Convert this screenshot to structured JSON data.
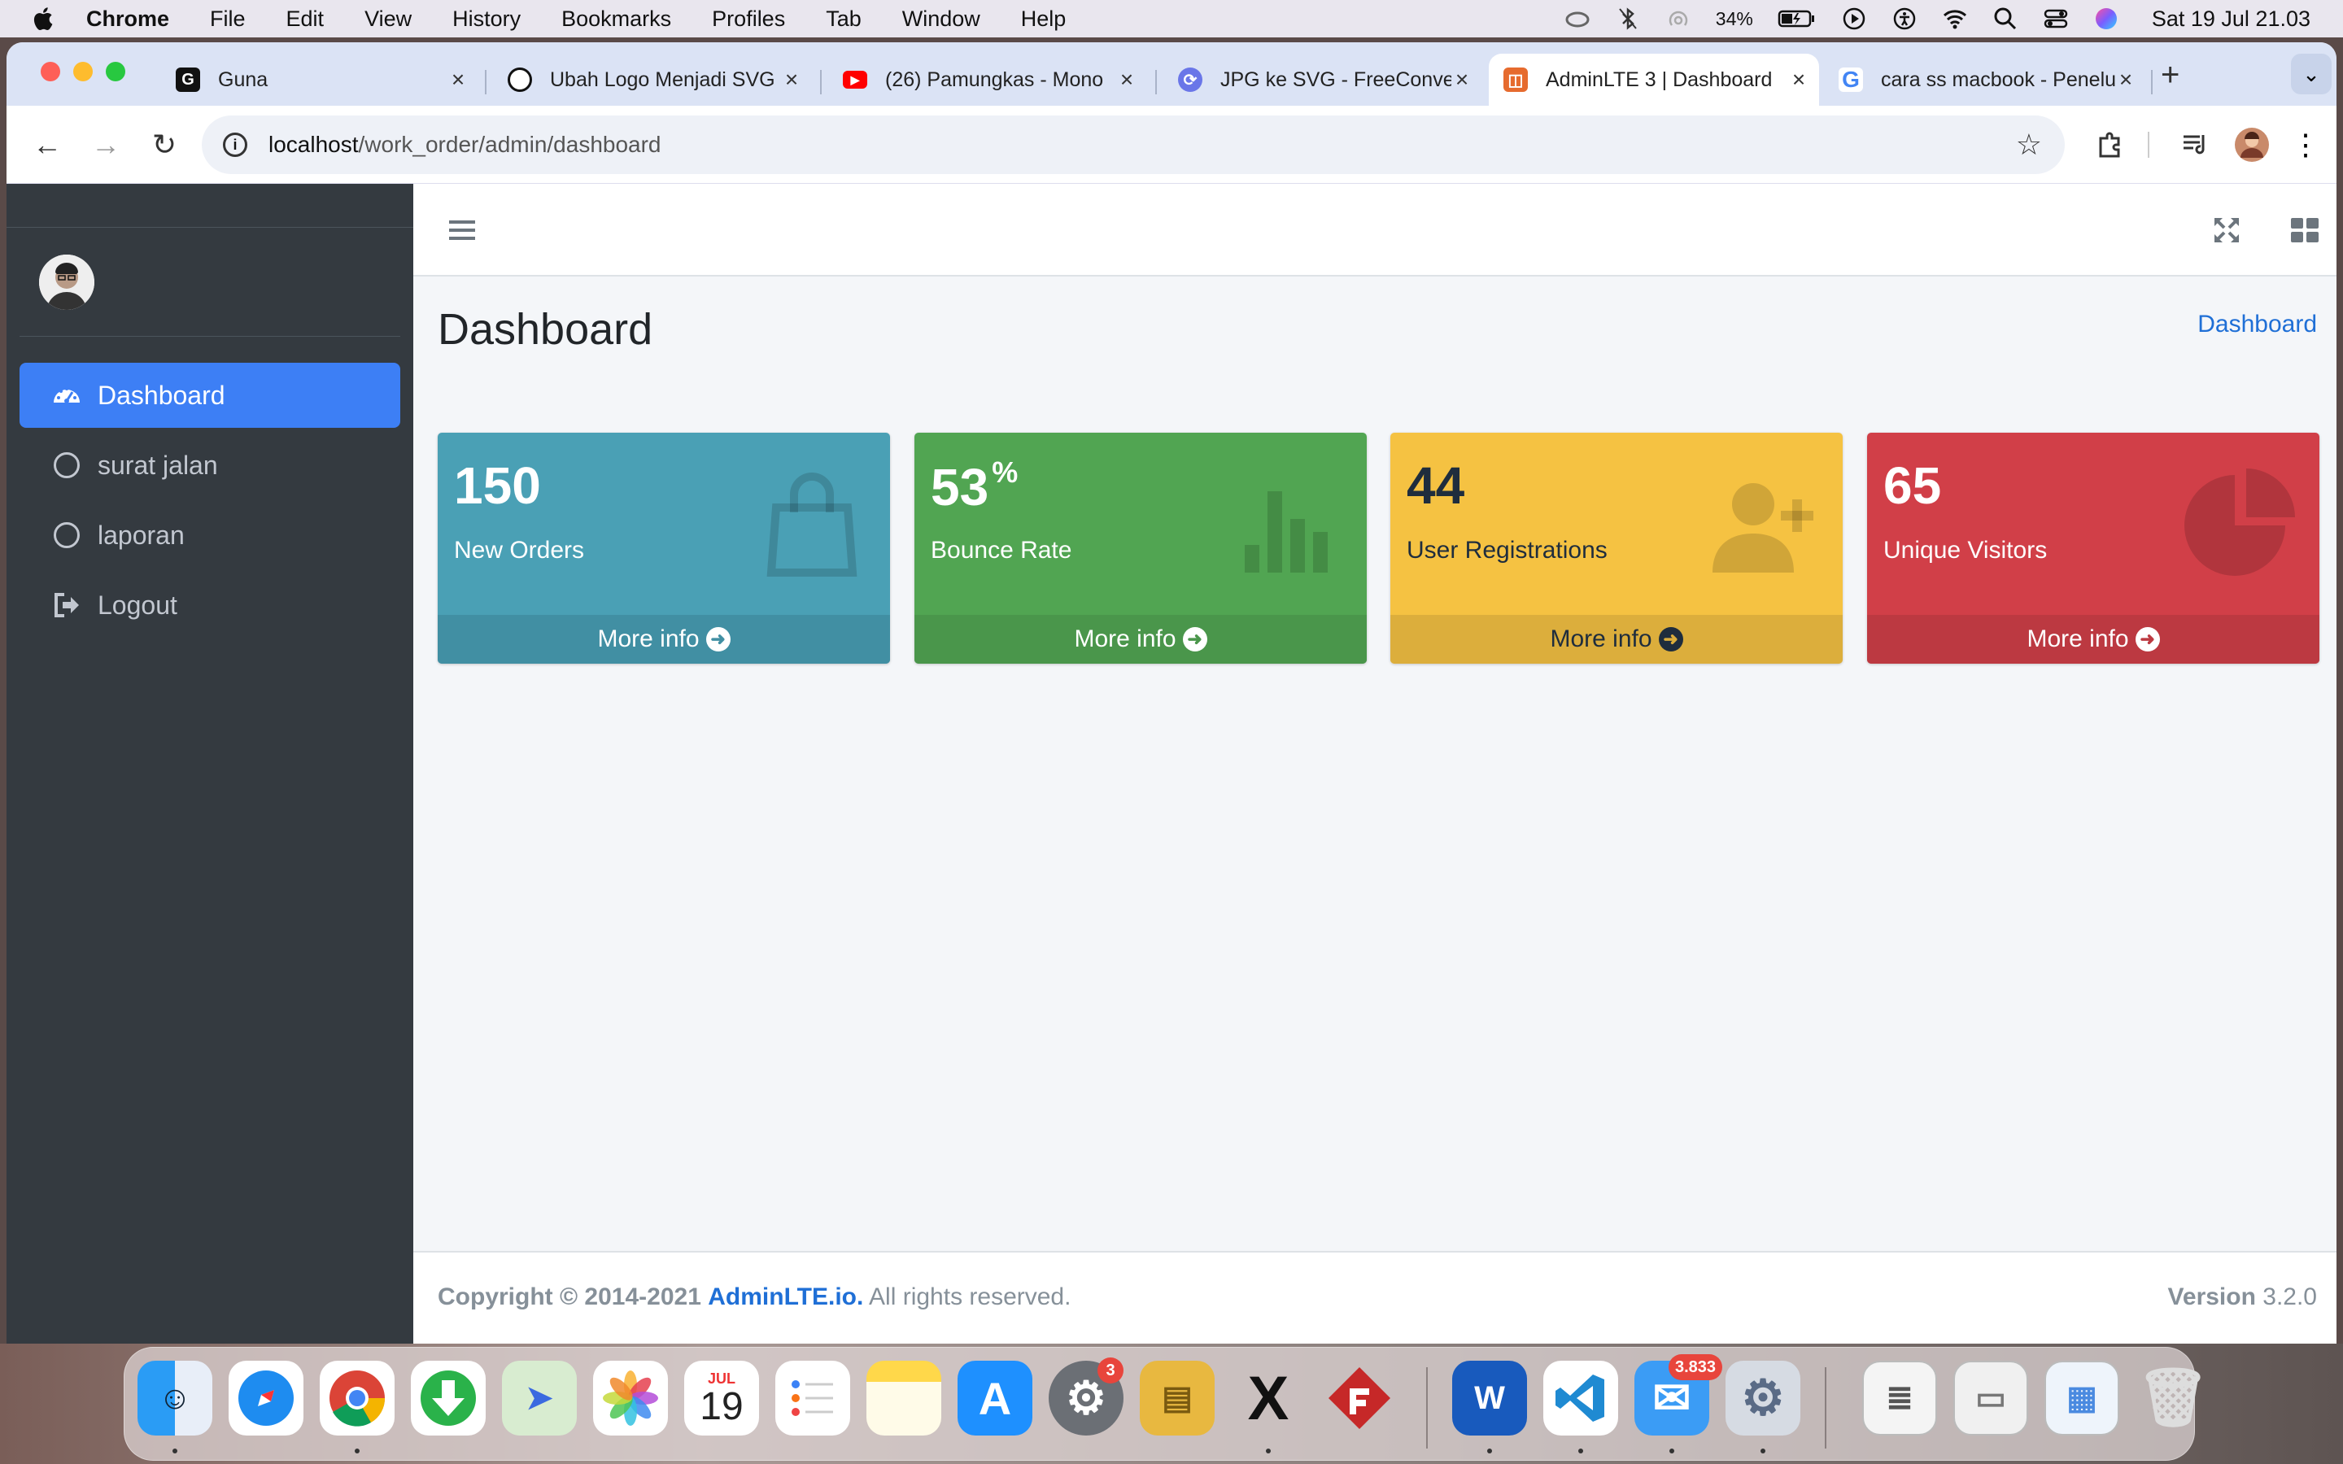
{
  "menubar": {
    "app": "Chrome",
    "items": [
      "File",
      "Edit",
      "View",
      "History",
      "Bookmarks",
      "Profiles",
      "Tab",
      "Window",
      "Help"
    ],
    "battery": "34%",
    "clock": "Sat 19 Jul  21.03"
  },
  "browser": {
    "tabs": [
      {
        "label": "Guna",
        "favicon": "G"
      },
      {
        "label": "Ubah Logo Menjadi SVG",
        "favicon": "openai"
      },
      {
        "label": "(26) Pamungkas - Mono",
        "favicon": "youtube"
      },
      {
        "label": "JPG ke SVG - FreeConvert",
        "favicon": "freeconvert"
      },
      {
        "label": "AdminLTE 3 | Dashboard",
        "favicon": "adminlte"
      },
      {
        "label": "cara ss macbook - Penelusuran",
        "favicon": "google"
      }
    ],
    "url_host": "localhost",
    "url_path": "/work_order/admin/dashboard"
  },
  "sidebar": {
    "items": [
      {
        "label": "Dashboard",
        "icon": "tachometer-icon",
        "active": true
      },
      {
        "label": "surat jalan",
        "icon": "circle-icon"
      },
      {
        "label": "laporan",
        "icon": "circle-icon"
      },
      {
        "label": "Logout",
        "icon": "sign-out-icon"
      }
    ]
  },
  "page": {
    "title": "Dashboard",
    "breadcrumb": "Dashboard"
  },
  "boxes": [
    {
      "value": "150",
      "suffix": "",
      "label": "New Orders",
      "footer": "More info",
      "icon": "shopping-bag-icon",
      "color": "#4aa0b5"
    },
    {
      "value": "53",
      "suffix": "%",
      "label": "Bounce Rate",
      "footer": "More info",
      "icon": "bar-chart-icon",
      "color": "#51a552"
    },
    {
      "value": "44",
      "suffix": "",
      "label": "User Registrations",
      "footer": "More info",
      "icon": "user-plus-icon",
      "color": "#f5c242"
    },
    {
      "value": "65",
      "suffix": "",
      "label": "Unique Visitors",
      "footer": "More info",
      "icon": "pie-chart-icon",
      "color": "#d13f48"
    }
  ],
  "footer": {
    "copyright_prefix": "Copyright © 2014-2021",
    "brand": "AdminLTE.io.",
    "rights": "All rights reserved.",
    "version_label": "Version",
    "version": "3.2.0"
  },
  "dock": {
    "calendar_month": "JUL",
    "calendar_day": "19",
    "settings_badge": "3",
    "mail_badge": "3.833"
  }
}
